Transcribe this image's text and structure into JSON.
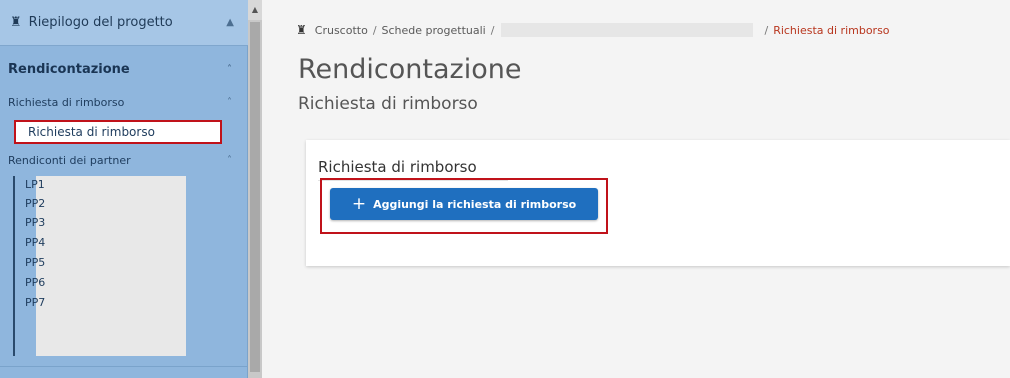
{
  "sidebar": {
    "top_item": {
      "icon": "home-icon",
      "label": "Riepilogo del progetto"
    },
    "section": {
      "label": "Rendicontazione"
    },
    "group_claim": {
      "label": "Richiesta di rimborso",
      "active_item": "Richiesta di rimborso"
    },
    "group_partners": {
      "label": "Rendiconti dei partner",
      "items": [
        "LP1",
        "PP2",
        "PP3",
        "PP4",
        "PP5",
        "PP6",
        "PP7"
      ]
    }
  },
  "breadcrumb": {
    "home_icon": "home-icon",
    "items": [
      "Cruscotto",
      "Schede progettuali",
      "Richiesta di rimborso"
    ],
    "separator": "/"
  },
  "main": {
    "title": "Rendicontazione",
    "subtitle": "Richiesta di rimborso",
    "card_title": "Richiesta di rimborso",
    "add_button": {
      "icon": "+",
      "label": "Aggiungi la richiesta di rimborso"
    }
  },
  "colors": {
    "sidebar_bg": "#8fb6dd",
    "primary_button": "#1f6fbf",
    "highlight_border": "#c0121a",
    "breadcrumb_current": "#b8361e"
  }
}
